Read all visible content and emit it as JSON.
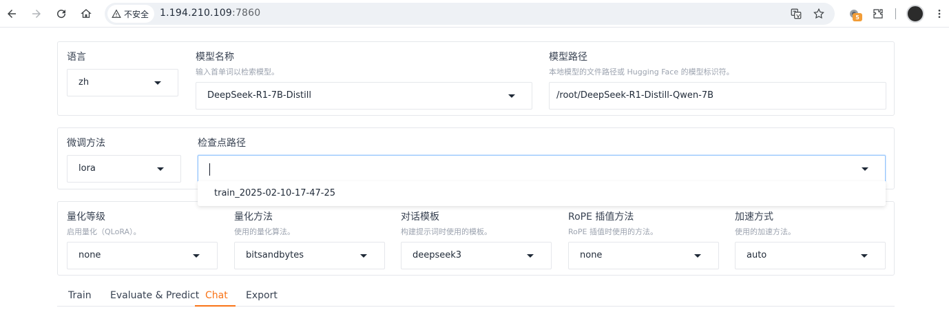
{
  "browser": {
    "security_label": "不安全",
    "url_host": "1.194.210.109",
    "url_port": ":7860",
    "extension_badge": "5"
  },
  "model_panel": {
    "language": {
      "label": "语言",
      "value": "zh"
    },
    "model_name": {
      "label": "模型名称",
      "hint": "输入首单词以检索模型。",
      "value": "DeepSeek-R1-7B-Distill"
    },
    "model_path": {
      "label": "模型路径",
      "hint": "本地模型的文件路径或 Hugging Face 的模型标识符。",
      "value": "/root/DeepSeek-R1-Distill-Qwen-7B"
    }
  },
  "finetune_panel": {
    "method": {
      "label": "微调方法",
      "value": "lora"
    },
    "checkpoint": {
      "label": "检查点路径",
      "value": "",
      "options": [
        "train_2025-02-10-17-47-25"
      ]
    }
  },
  "advanced_panel": {
    "quant_level": {
      "label": "量化等级",
      "hint": "启用量化（QLoRA）。",
      "value": "none"
    },
    "quant_method": {
      "label": "量化方法",
      "hint": "使用的量化算法。",
      "value": "bitsandbytes"
    },
    "template": {
      "label": "对话模板",
      "hint": "构建提示词时使用的模板。",
      "value": "deepseek3"
    },
    "rope": {
      "label": "RoPE 插值方法",
      "hint": "RoPE 插值时使用的方法。",
      "value": "none"
    },
    "booster": {
      "label": "加速方式",
      "hint": "使用的加速方法。",
      "value": "auto"
    }
  },
  "tabs": [
    {
      "label": "Train"
    },
    {
      "label": "Evaluate & Predict"
    },
    {
      "label": "Chat",
      "active": true
    },
    {
      "label": "Export"
    }
  ],
  "colors": {
    "accent": "#f97316",
    "focus_border": "#93c5fd"
  }
}
